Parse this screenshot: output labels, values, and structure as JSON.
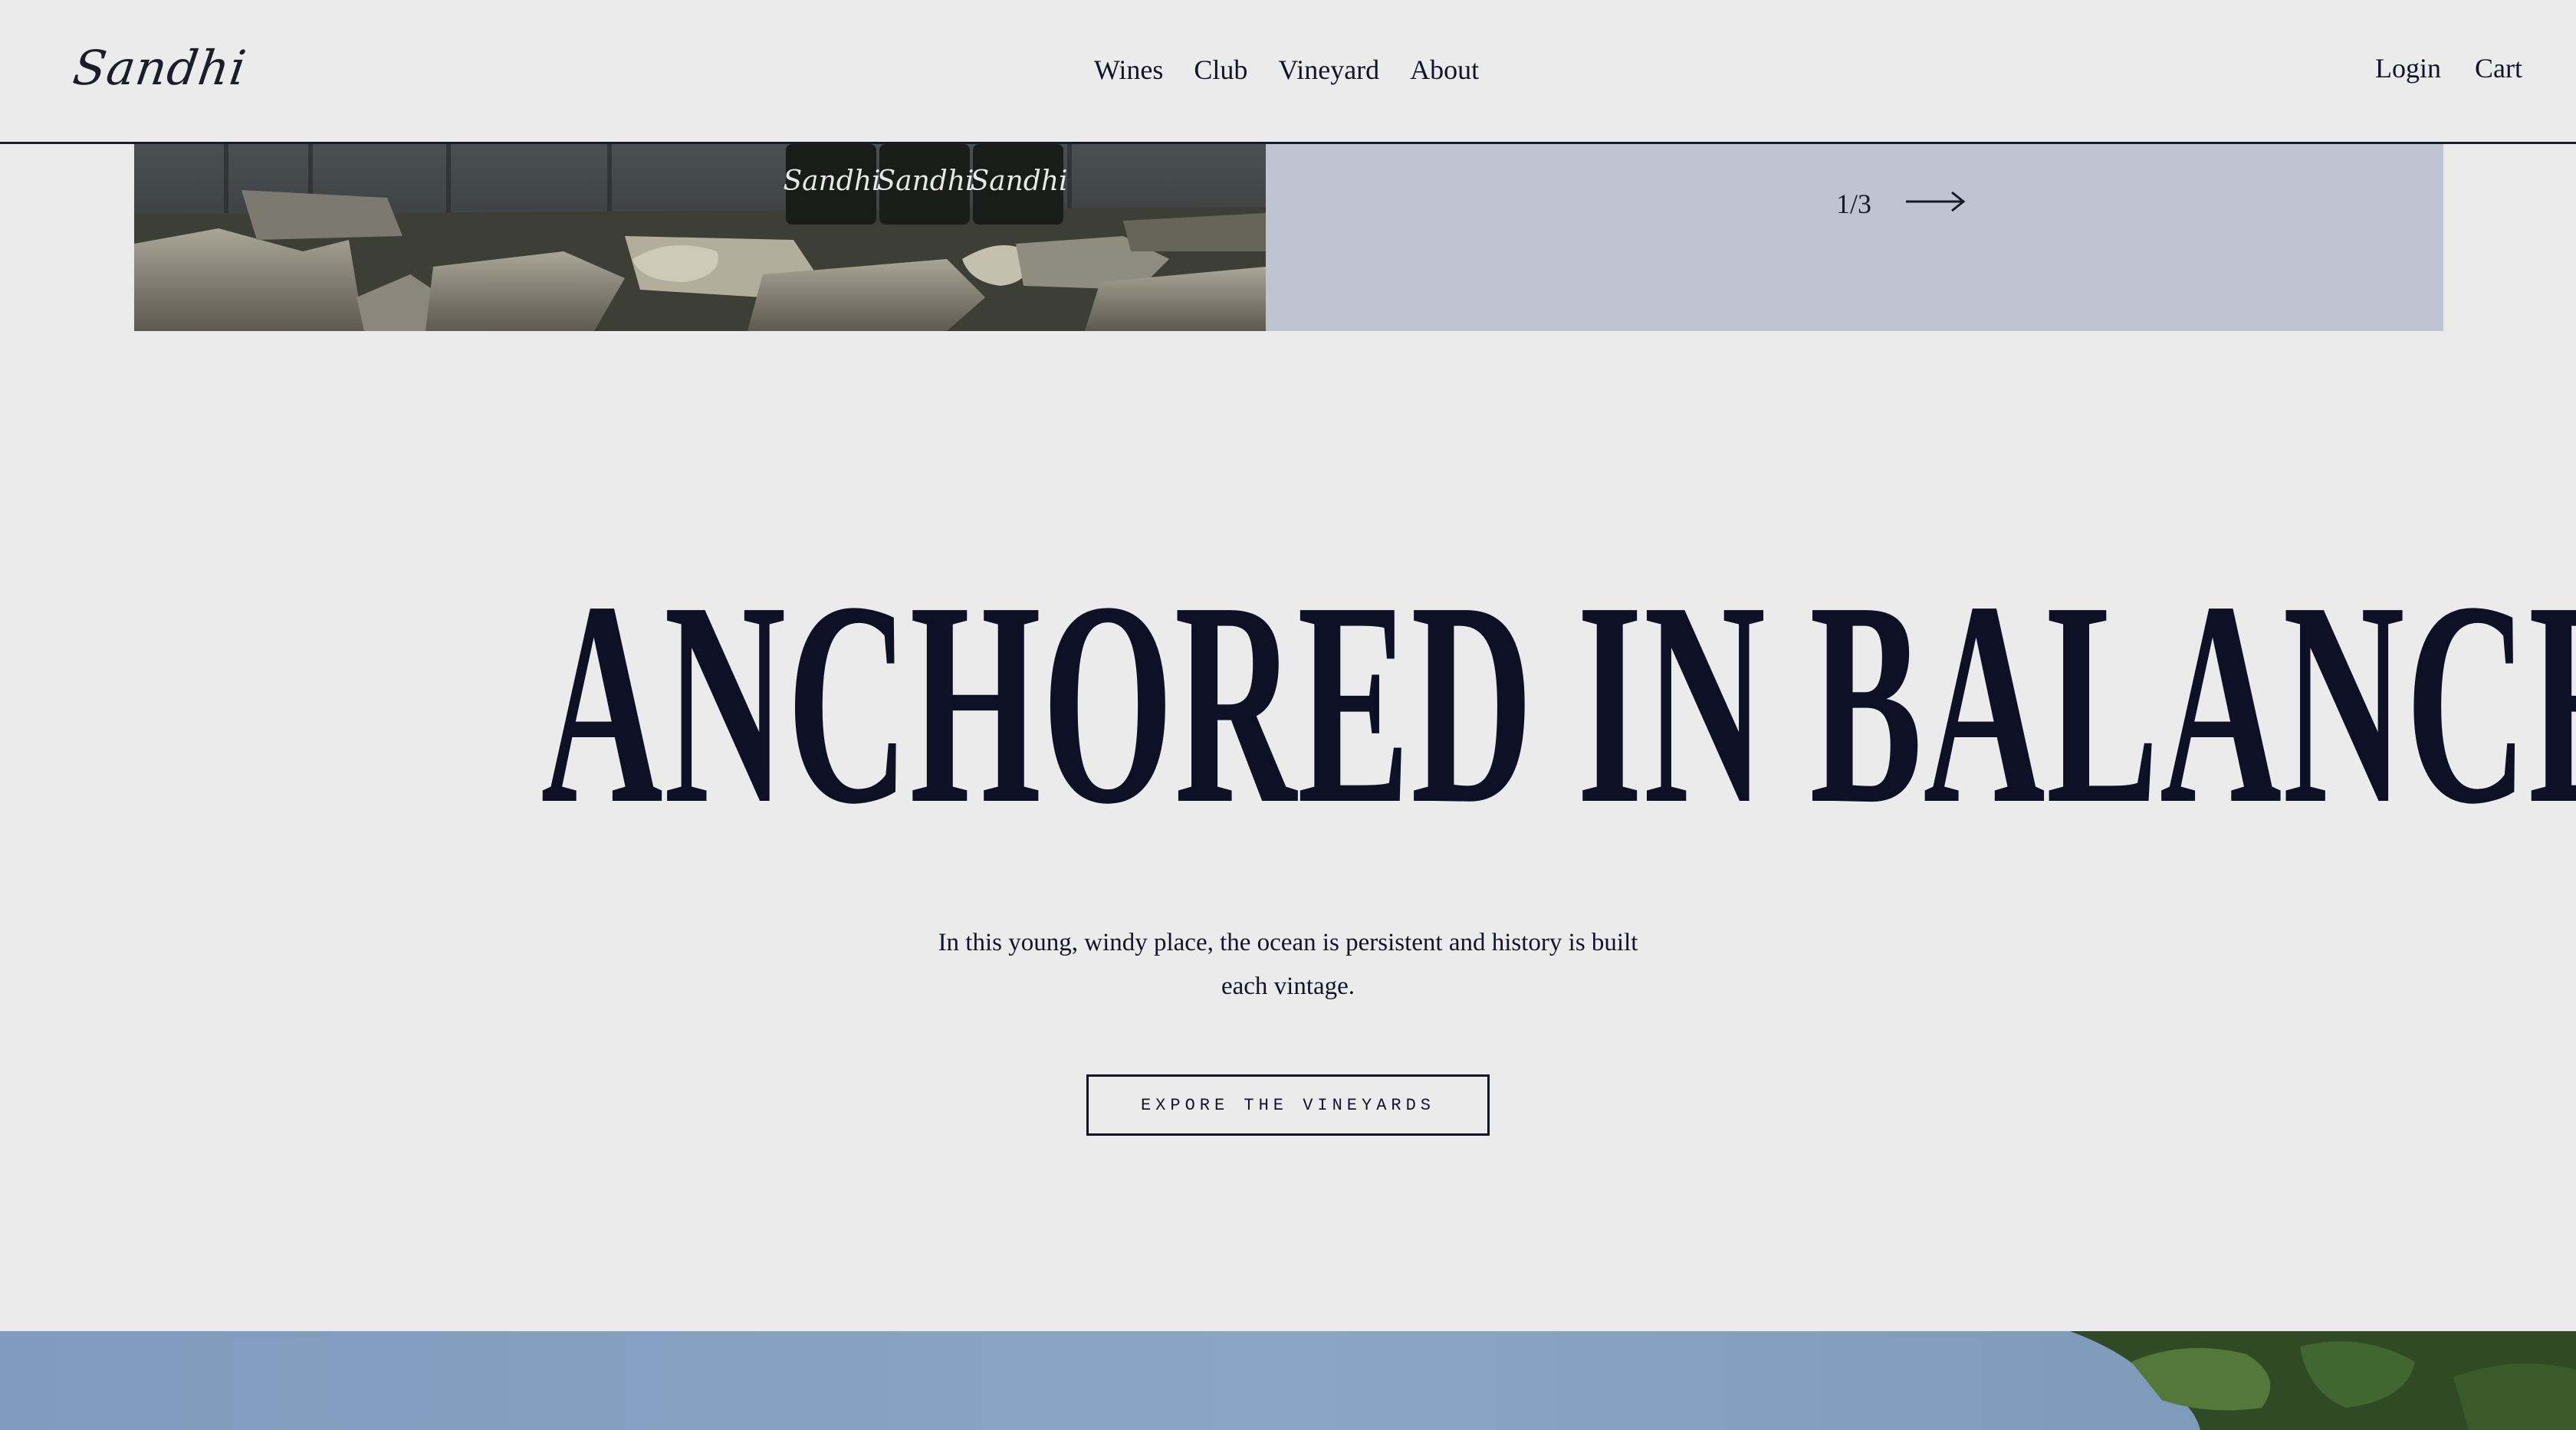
{
  "header": {
    "logo": "Sandhi",
    "nav": [
      "Wines",
      "Club",
      "Vineyard",
      "About"
    ],
    "account": {
      "login": "Login",
      "cart": "Cart"
    }
  },
  "slider": {
    "counter": "1/3",
    "next_icon": "arrow-right-icon",
    "photo_icon": "wine-bottles-on-stones-photo",
    "bottle_label": "Sandhi"
  },
  "hero": {
    "headline": "ANCHORED IN BALANCE",
    "subcopy": "In this young, windy place, the ocean is persistent and history is built each vintage.",
    "cta": "EXPORE THE VINEYARDS"
  },
  "footer_photo": {
    "icon": "vineyard-sky-photo"
  },
  "colors": {
    "background": "#ebebeb",
    "panel": "#bec4d1",
    "ink": "#121528"
  }
}
